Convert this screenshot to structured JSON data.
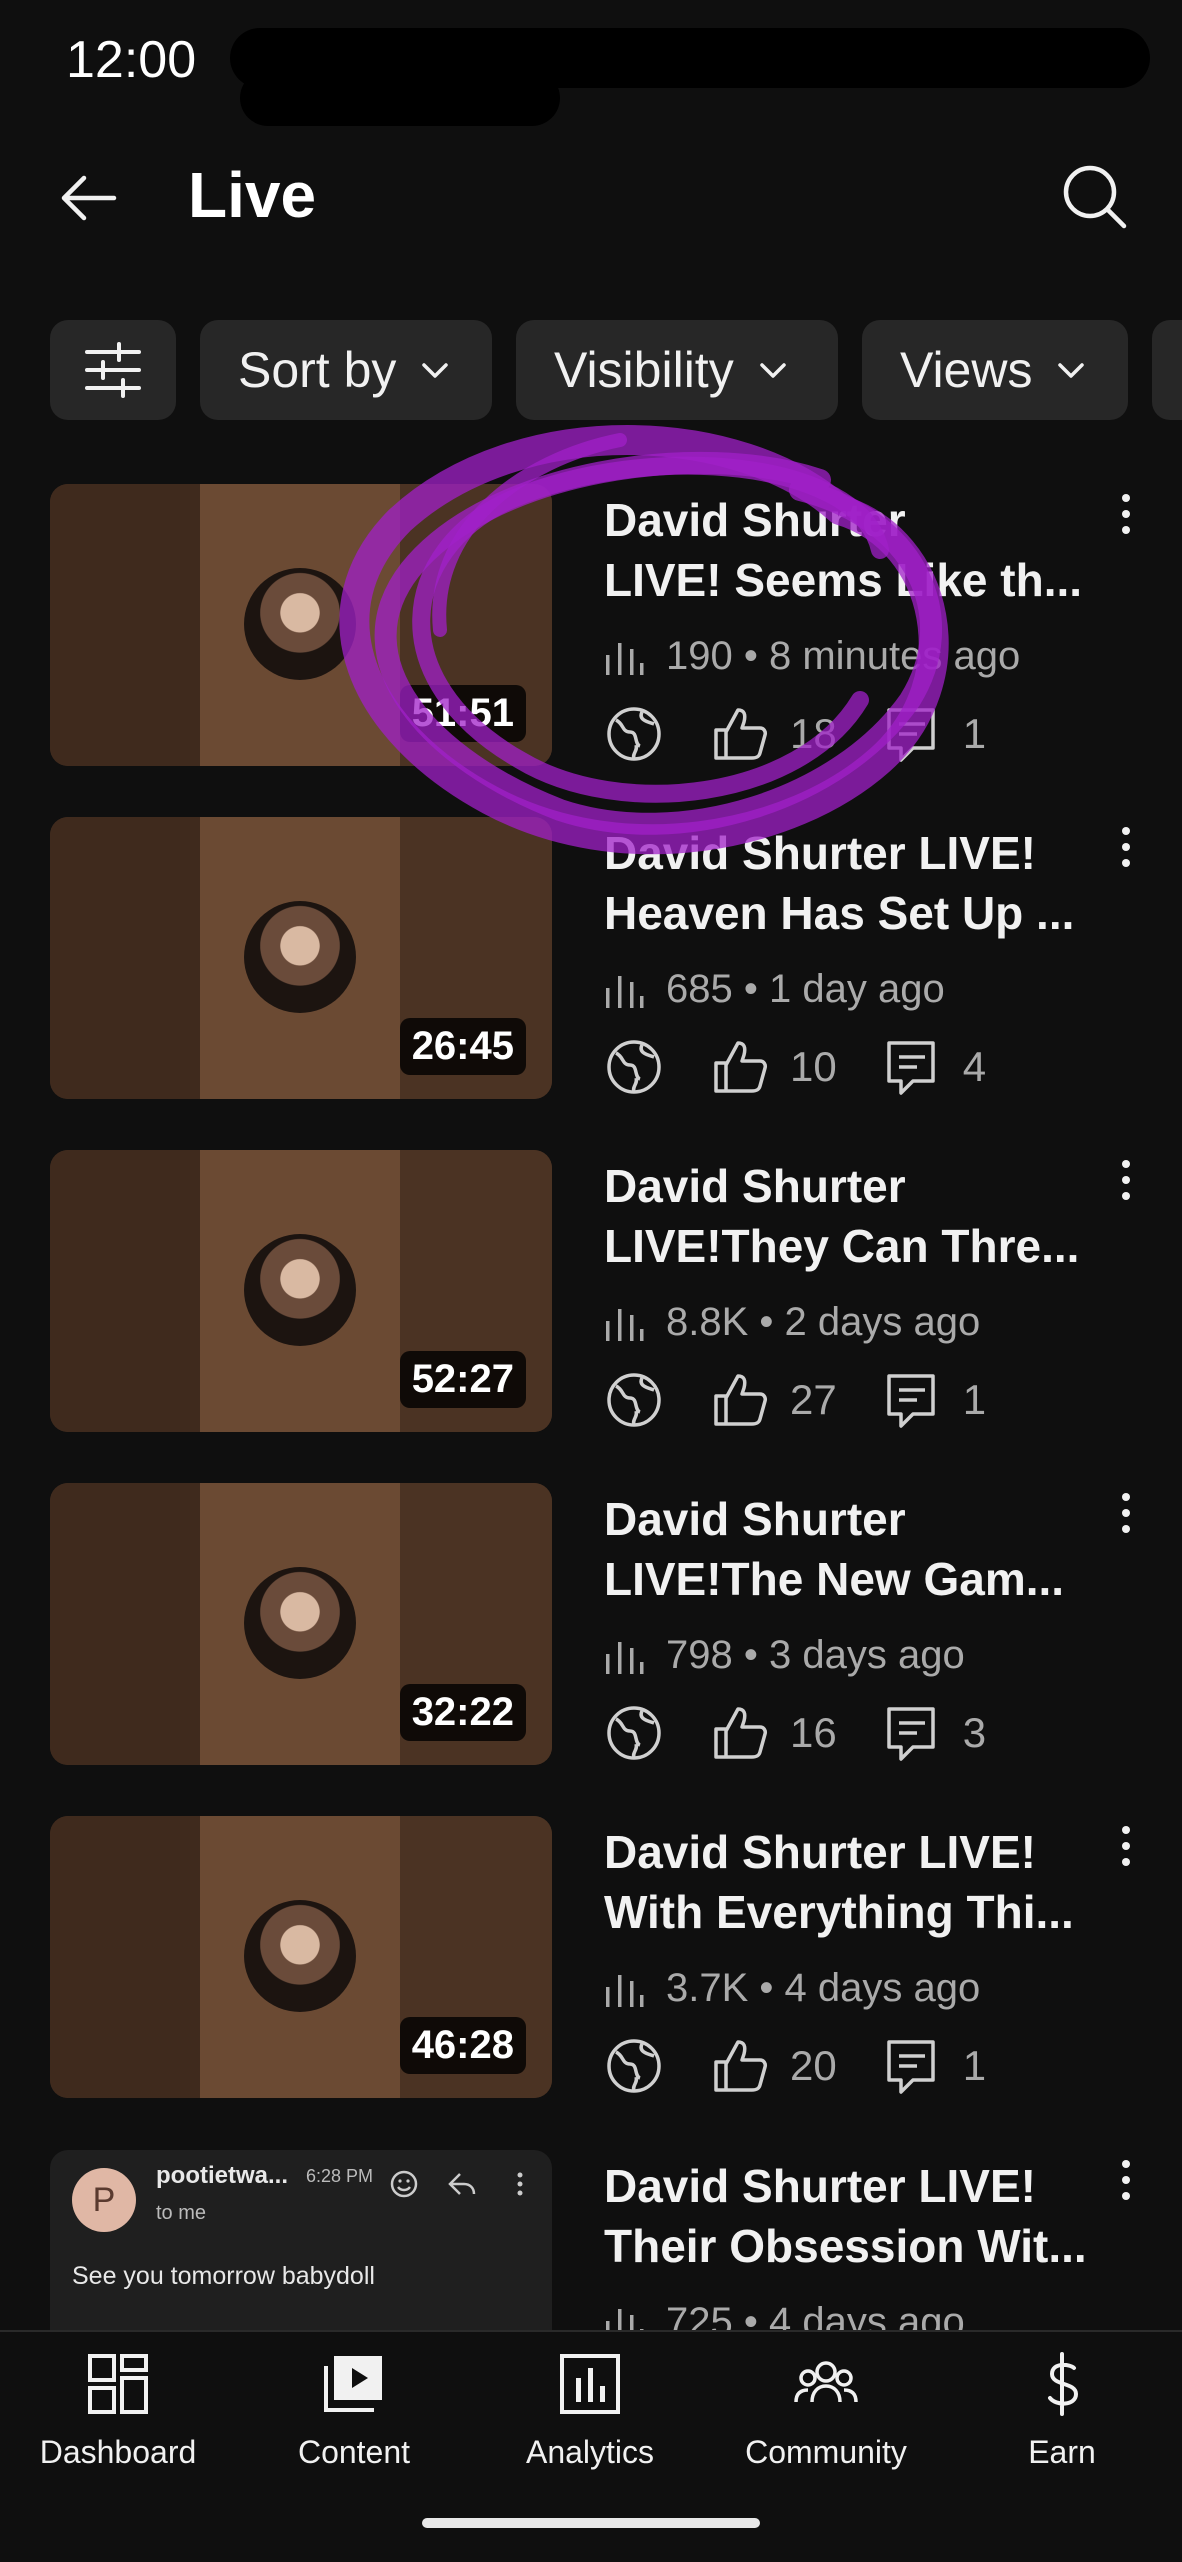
{
  "status_bar": {
    "time": "12:00"
  },
  "header": {
    "title": "Live"
  },
  "filters": [
    {
      "label": "",
      "icon": "filter-sliders-icon"
    },
    {
      "label": "Sort by"
    },
    {
      "label": "Visibility"
    },
    {
      "label": "Views"
    }
  ],
  "videos": [
    {
      "title_line1": "David Shurter",
      "title_line2": "LIVE! Seems Like th...",
      "duration": "51:51",
      "views": "190",
      "age": "8 minutes ago",
      "likes": "18",
      "comments": "1"
    },
    {
      "title_line1": "David Shurter LIVE!",
      "title_line2": "Heaven Has Set Up ...",
      "duration": "26:45",
      "views": "685",
      "age": "1 day ago",
      "likes": "10",
      "comments": "4"
    },
    {
      "title_line1": "David Shurter",
      "title_line2": "LIVE!They Can Thre...",
      "duration": "52:27",
      "views": "8.8K",
      "age": "2 days ago",
      "likes": "27",
      "comments": "1"
    },
    {
      "title_line1": "David Shurter",
      "title_line2": "LIVE!The New Gam...",
      "duration": "32:22",
      "views": "798",
      "age": "3 days ago",
      "likes": "16",
      "comments": "3"
    },
    {
      "title_line1": "David Shurter LIVE!",
      "title_line2": "With Everything Thi...",
      "duration": "46:28",
      "views": "3.7K",
      "age": "4 days ago",
      "likes": "20",
      "comments": "1"
    },
    {
      "title_line1": "David Shurter LIVE!",
      "title_line2": "Their Obsession Wit...",
      "views": "725",
      "age": "4 days ago"
    }
  ],
  "email_overlay": {
    "avatar_letter": "P",
    "sender": "pootietwa...",
    "time": "6:28 PM",
    "to": "to me",
    "body": "See you tomorrow babydoll"
  },
  "bottom_nav": [
    {
      "label": "Dashboard",
      "icon": "dashboard-icon"
    },
    {
      "label": "Content",
      "icon": "content-play-icon"
    },
    {
      "label": "Analytics",
      "icon": "analytics-bar-chart-icon"
    },
    {
      "label": "Community",
      "icon": "community-people-icon"
    },
    {
      "label": "Earn",
      "icon": "dollar-icon"
    }
  ],
  "colors": {
    "background": "#0f0f0f",
    "chip": "#272727",
    "scribble": "#a020c8",
    "secondary_text": "#aaaaaa"
  }
}
